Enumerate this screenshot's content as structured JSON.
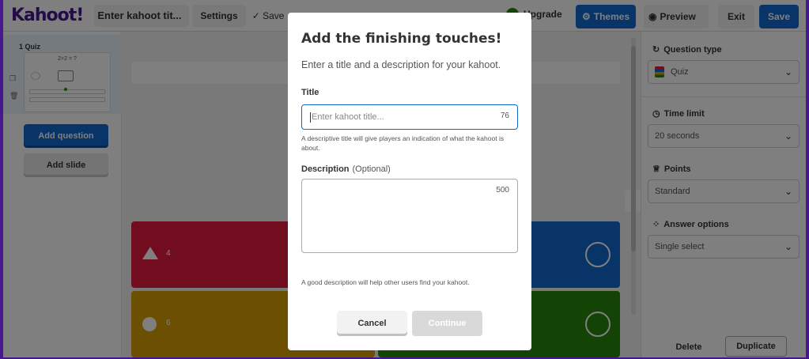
{
  "topbar": {
    "logo": "Kahoot!",
    "title_input": "Enter kahoot tit...",
    "settings": "Settings",
    "saved": "✓ Save",
    "upgrade": "Upgrade",
    "themes": "Themes",
    "preview": "Preview",
    "exit": "Exit",
    "save": "Save"
  },
  "sidebar": {
    "slide_number": "1 Quiz",
    "slide_question": "2+2 = ?",
    "add_question": "Add question",
    "add_slide": "Add slide"
  },
  "canvas": {
    "answers": [
      {
        "label": "4",
        "color": "#e21b3c"
      },
      {
        "label": "",
        "color": "#1368ce"
      },
      {
        "label": "6",
        "color": "#d89e00"
      },
      {
        "label": "",
        "color": "#26890c"
      }
    ]
  },
  "right_panel": {
    "question_type_label": "Question type",
    "question_type_value": "Quiz",
    "time_limit_label": "Time limit",
    "time_limit_value": "20 seconds",
    "points_label": "Points",
    "points_value": "Standard",
    "answer_options_label": "Answer options",
    "answer_options_value": "Single select",
    "delete": "Delete",
    "duplicate": "Duplicate"
  },
  "modal": {
    "title": "Add the finishing touches!",
    "subtitle": "Enter a title and a description for your kahoot.",
    "title_label": "Title",
    "title_placeholder": "Enter kahoot title...",
    "title_counter": "76",
    "title_hint": "A descriptive title will give players an indication of what the kahoot is about.",
    "description_label": "Description",
    "description_optional": "(Optional)",
    "description_counter": "500",
    "description_hint": "A good description will help other users find your kahoot.",
    "cancel": "Cancel",
    "continue": "Continue"
  },
  "colors": {
    "brand_purple": "#46178f",
    "primary_blue": "#1368ce",
    "red": "#e21b3c",
    "yellow": "#d89e00",
    "green": "#26890c"
  }
}
